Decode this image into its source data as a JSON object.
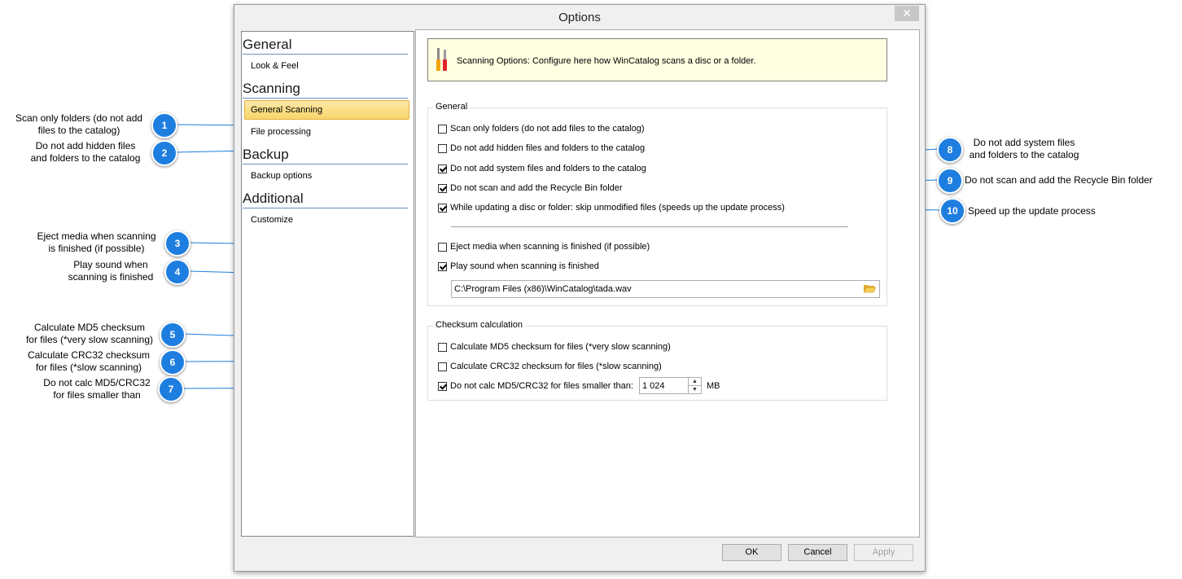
{
  "window": {
    "title": "Options",
    "close_icon": "close-icon"
  },
  "nav": {
    "sections": [
      {
        "heading": "General",
        "items": [
          "Look & Feel"
        ]
      },
      {
        "heading": "Scanning",
        "items": [
          "General Scanning",
          "File processing"
        ]
      },
      {
        "heading": "Backup",
        "items": [
          "Backup options"
        ]
      },
      {
        "heading": "Additional",
        "items": [
          "Customize"
        ]
      }
    ],
    "selected": "General Scanning"
  },
  "banner": {
    "icon": "tools-icon",
    "text": "Scanning Options: Configure here how WinCatalog scans a disc or a folder."
  },
  "general_group": {
    "title": "General",
    "options": [
      {
        "label": "Scan only folders (do not add files to the catalog)",
        "checked": false
      },
      {
        "label": "Do not add hidden files and folders to the catalog",
        "checked": false
      },
      {
        "label": "Do not add system files and folders to the catalog",
        "checked": true
      },
      {
        "label": "Do not scan and add the Recycle Bin folder",
        "checked": true
      },
      {
        "label": "While updating a disc or folder: skip unmodified files (speeds up the update process)",
        "checked": true
      },
      {
        "label": "Eject media when scanning is finished (if possible)",
        "checked": false
      },
      {
        "label": "Play sound when scanning is finished",
        "checked": true
      }
    ],
    "sound_path": "C:\\Program Files (x86)\\WinCatalog\\tada.wav",
    "browse_icon": "folder-open-icon"
  },
  "checksum_group": {
    "title": "Checksum calculation",
    "options": [
      {
        "label": "Calculate MD5 checksum for files (*very slow scanning)",
        "checked": false
      },
      {
        "label": "Calculate CRC32 checksum for files (*slow scanning)",
        "checked": false
      },
      {
        "label": "Do not calc MD5/CRC32 for files smaller than:",
        "checked": true
      }
    ],
    "size_value": "1 024",
    "size_unit": "MB"
  },
  "buttons": {
    "ok": "OK",
    "cancel": "Cancel",
    "apply": "Apply"
  },
  "callouts": [
    {
      "num": "1",
      "text1": "Scan only folders (do not add",
      "text2": "files to the catalog)"
    },
    {
      "num": "2",
      "text1": "Do not add hidden files",
      "text2": "and folders to the catalog"
    },
    {
      "num": "3",
      "text1": "Eject media when scanning",
      "text2": "is finished (if possible)"
    },
    {
      "num": "4",
      "text1": "Play sound when",
      "text2": "scanning is finished"
    },
    {
      "num": "5",
      "text1": "Calculate MD5 checksum",
      "text2": "for files (*very slow scanning)"
    },
    {
      "num": "6",
      "text1": "Calculate CRC32 checksum",
      "text2": "for files (*slow scanning)"
    },
    {
      "num": "7",
      "text1": "Do not calc MD5/CRC32",
      "text2": "for files smaller than"
    },
    {
      "num": "8",
      "text1": "Do not add system files",
      "text2": "and folders to the catalog"
    },
    {
      "num": "9",
      "text1": "Do not scan and add the Recycle Bin folder",
      "text2": ""
    },
    {
      "num": "10",
      "text1": "Speed up the update process",
      "text2": ""
    }
  ],
  "colors": {
    "callout_badge": "#1e7ee0",
    "nav_selected": "#f8d66a",
    "banner_bg": "#ffffe1"
  }
}
